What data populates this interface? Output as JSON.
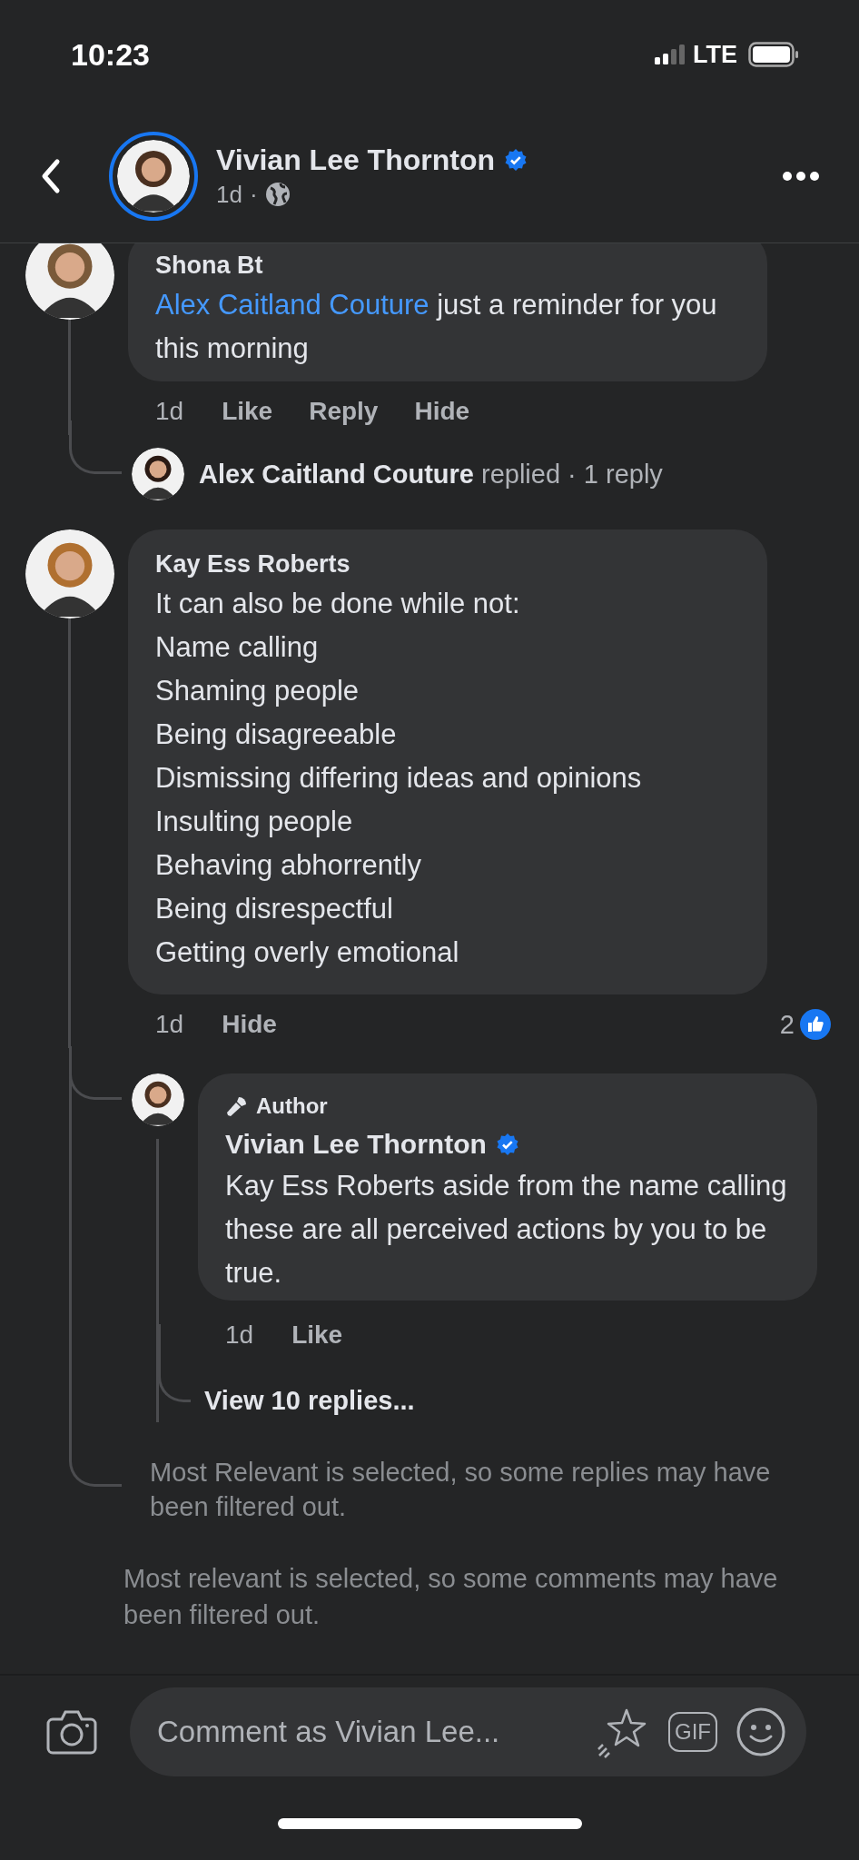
{
  "status_bar": {
    "time": "10:23",
    "network": "LTE"
  },
  "header": {
    "name": "Vivian Lee Thornton",
    "verified": true,
    "time": "1d",
    "separator": "·"
  },
  "comments": [
    {
      "author": "Shona Bt",
      "mention": "Alex Caitland Couture",
      "lines": [
        "just a reminder for you this morning"
      ],
      "actions": [
        {
          "kind": "time",
          "label": "1d"
        },
        {
          "kind": "action",
          "label": "Like"
        },
        {
          "kind": "action",
          "label": "Reply"
        },
        {
          "kind": "action",
          "label": "Hide"
        }
      ],
      "replied": {
        "name": "Alex Caitland Couture",
        "summary": "replied · 1 reply"
      }
    },
    {
      "author": "Kay Ess Roberts",
      "lines": [
        "It can also be done while not:",
        "Name calling",
        "Shaming people",
        "Being disagreeable",
        "Dismissing differing ideas and opinions",
        "Insulting people",
        "Behaving abhorrently",
        "Being disrespectful",
        "Getting overly emotional"
      ],
      "actions": [
        {
          "kind": "time",
          "label": "1d"
        },
        {
          "kind": "action",
          "label": "Hide"
        }
      ],
      "reactions": "2",
      "replies": [
        {
          "badge": "Author",
          "author": "Vivian Lee Thornton",
          "verified": true,
          "text": "Kay Ess Roberts aside from the name calling these are all perceived actions by you to be true.",
          "actions": [
            {
              "kind": "time",
              "label": "1d"
            },
            {
              "kind": "action",
              "label": "Like"
            }
          ],
          "view_replies": "View 10 replies..."
        }
      ],
      "filter_note": "Most Relevant is selected, so some replies may have been filtered out."
    }
  ],
  "filter_note": "Most relevant is selected, so some comments may have been filtered out.",
  "composer": {
    "placeholder": "Comment as Vivian Lee...",
    "gif_label": "GIF"
  }
}
